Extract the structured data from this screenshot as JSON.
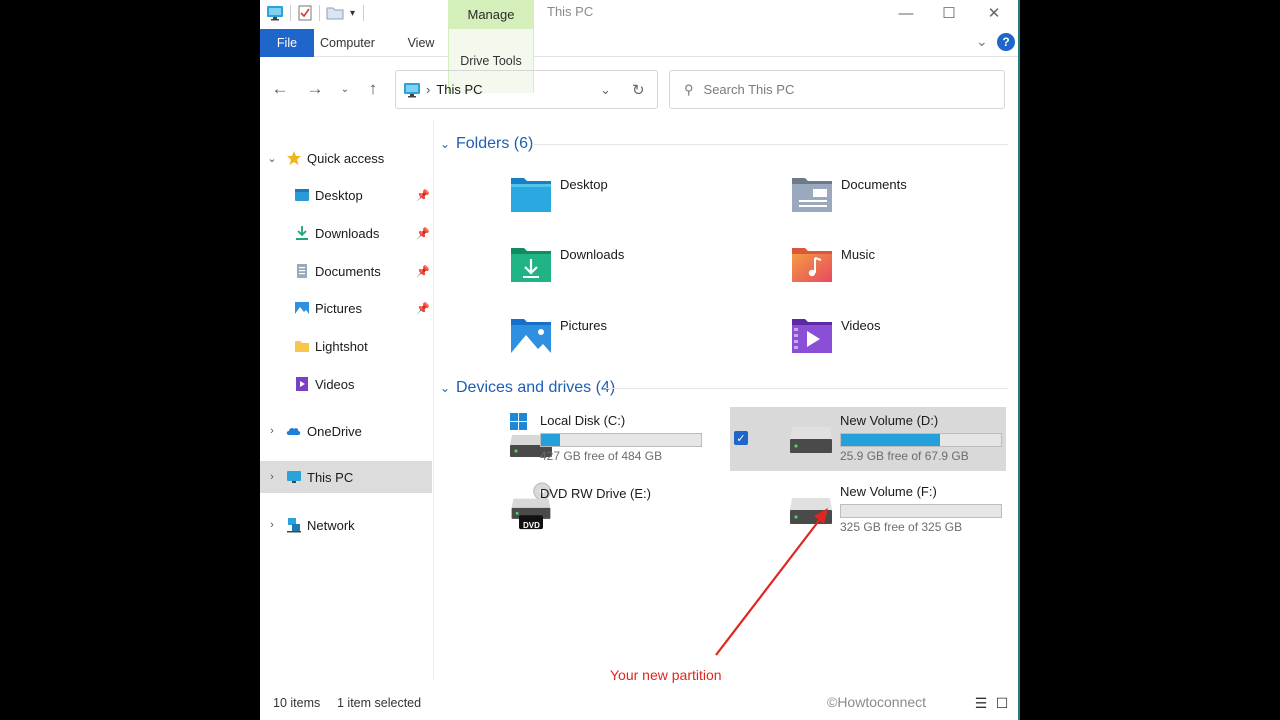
{
  "window": {
    "manage_tab": "Manage",
    "title": "This PC",
    "minimize": "—",
    "maximize": "☐",
    "close": "✕",
    "expand_ribbon": "⌄",
    "help": "?"
  },
  "ribbon": {
    "tabs": [
      "File",
      "Computer",
      "View",
      "Drive Tools"
    ]
  },
  "address": {
    "location": "This PC",
    "separator": "›"
  },
  "search": {
    "placeholder": "Search This PC"
  },
  "nav": {
    "quick_access": "Quick access",
    "items": [
      {
        "label": "Desktop",
        "pinned": true
      },
      {
        "label": "Downloads",
        "pinned": true
      },
      {
        "label": "Documents",
        "pinned": true
      },
      {
        "label": "Pictures",
        "pinned": true
      },
      {
        "label": "Lightshot",
        "pinned": false
      },
      {
        "label": "Videos",
        "pinned": false
      }
    ],
    "onedrive": "OneDrive",
    "this_pc": "This PC",
    "network": "Network"
  },
  "folders": {
    "header": "Folders (6)",
    "items": [
      "Desktop",
      "Documents",
      "Downloads",
      "Music",
      "Pictures",
      "Videos"
    ]
  },
  "drives": {
    "header": "Devices and drives (4)",
    "items": [
      {
        "name": "Local Disk (C:)",
        "free": "427 GB free of 484 GB",
        "used_fraction": 0.12
      },
      {
        "name": "New Volume (D:)",
        "free": "25.9 GB free of 67.9 GB",
        "used_fraction": 0.62
      },
      {
        "name": "DVD RW Drive (E:)",
        "dvd_label": "DVD"
      },
      {
        "name": "New Volume (F:)",
        "free": "325 GB free of 325 GB",
        "used_fraction": 0.0
      }
    ]
  },
  "annotation": "Your new partition",
  "watermark": "©Howtoconnect",
  "status": {
    "items": "10 items",
    "selected": "1 item selected"
  },
  "colors": {
    "accent": "#1e66c9",
    "manage_tab": "#d4efb9",
    "drive_bar": "#26a0da",
    "annotation": "#e0261f"
  }
}
